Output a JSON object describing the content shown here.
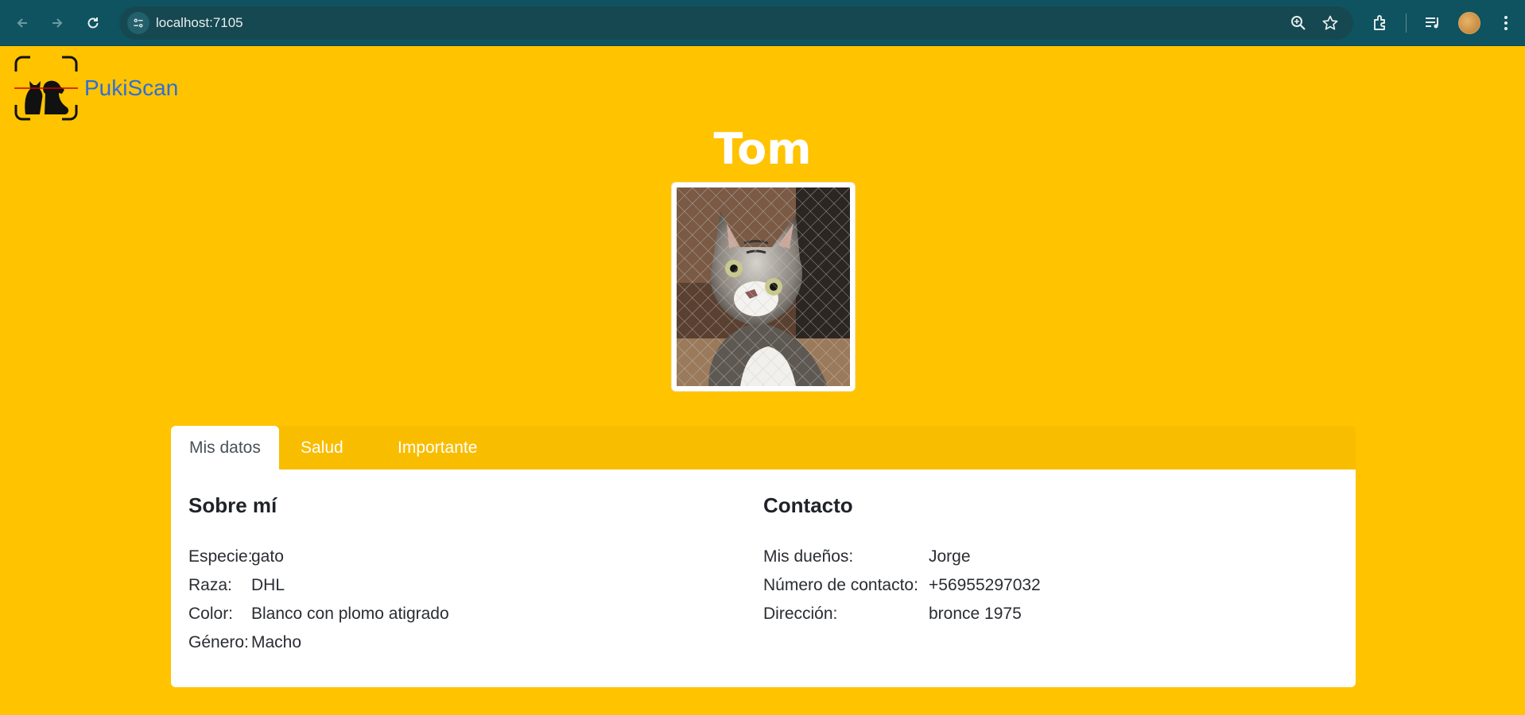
{
  "browser": {
    "url": "localhost:7105",
    "icons": [
      "back-icon",
      "forward-icon",
      "reload-icon",
      "site-info-icon",
      "zoom-icon",
      "star-icon",
      "extensions-icon",
      "media-icon",
      "profile-avatar",
      "menu-icon"
    ]
  },
  "brand": {
    "name": "PukiScan",
    "logo": "cat-dog-scan-logo"
  },
  "pet": {
    "name": "Tom",
    "photo_alt": "Tom"
  },
  "tabs": [
    {
      "label": "Mis datos",
      "active": true
    },
    {
      "label": "Salud",
      "active": false
    },
    {
      "label": "Importante",
      "active": false
    }
  ],
  "about": {
    "title": "Sobre mí",
    "rows": [
      {
        "key": "Especie:",
        "value": "gato"
      },
      {
        "key": "Raza:",
        "value": "DHL"
      },
      {
        "key": "Color:",
        "value": "Blanco con plomo atigrado"
      },
      {
        "key": "Género:",
        "value": "Macho"
      }
    ]
  },
  "contact": {
    "title": "Contacto",
    "rows": [
      {
        "key": "Mis dueños:",
        "value": "Jorge"
      },
      {
        "key": "Número de contacto:",
        "value": "+56955297032"
      },
      {
        "key": "Dirección:",
        "value": "bronce 1975"
      }
    ]
  },
  "colors": {
    "page_bg": "#ffc300",
    "brand_link": "#2f6fd6",
    "browser_bar": "#0f5360"
  }
}
